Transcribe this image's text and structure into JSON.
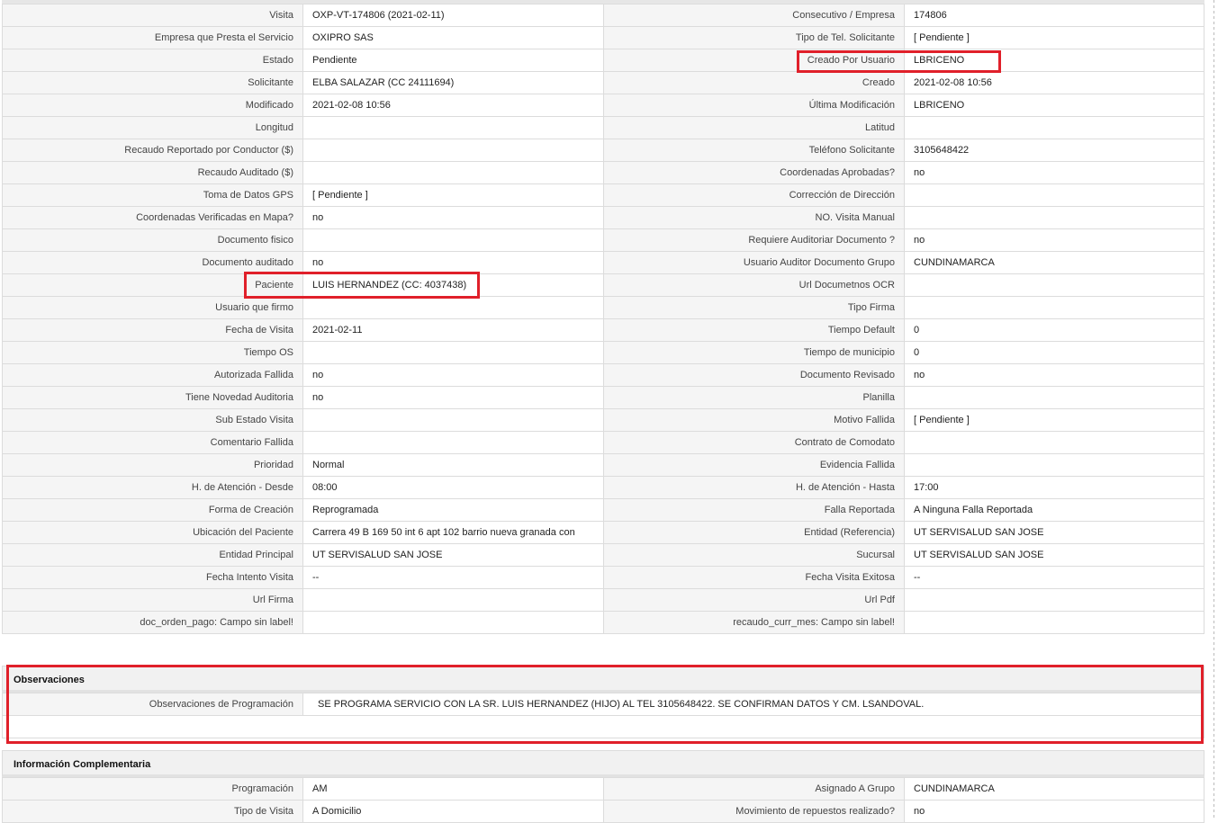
{
  "main_rows": [
    {
      "l1": "Visita",
      "v1": "OXP-VT-174806 (2021-02-11)",
      "l2": "Consecutivo / Empresa",
      "v2": "174806"
    },
    {
      "l1": "Empresa que Presta el Servicio",
      "v1": "OXIPRO SAS",
      "l2": "Tipo de Tel. Solicitante",
      "v2": "[ Pendiente ]"
    },
    {
      "l1": "Estado",
      "v1": "Pendiente",
      "l2": "Creado Por Usuario",
      "v2": "LBRICENO"
    },
    {
      "l1": "Solicitante",
      "v1": "ELBA SALAZAR (CC 24111694)",
      "l2": "Creado",
      "v2": "2021-02-08 10:56"
    },
    {
      "l1": "Modificado",
      "v1": "2021-02-08 10:56",
      "l2": "Última Modificación",
      "v2": " LBRICENO"
    },
    {
      "l1": "Longitud",
      "v1": "",
      "l2": "Latitud",
      "v2": ""
    },
    {
      "l1": "Recaudo Reportado por Conductor ($)",
      "v1": "",
      "l2": "Teléfono Solicitante",
      "v2": "3105648422"
    },
    {
      "l1": "Recaudo Auditado ($)",
      "v1": "",
      "l2": "Coordenadas Aprobadas?",
      "v2": " no"
    },
    {
      "l1": "Toma de Datos GPS",
      "v1": "[ Pendiente ]",
      "l2": "Corrección de Dirección",
      "v2": ""
    },
    {
      "l1": "Coordenadas Verificadas en Mapa?",
      "v1": " no",
      "l2": "NO. Visita Manual",
      "v2": ""
    },
    {
      "l1": "Documento fisico",
      "v1": "",
      "l2": "Requiere Auditoriar Documento ?",
      "v2": " no"
    },
    {
      "l1": "Documento auditado",
      "v1": "no",
      "l2": "Usuario Auditor Documento Grupo",
      "v2": "CUNDINAMARCA"
    },
    {
      "l1": "Paciente",
      "v1": "LUIS HERNANDEZ (CC: 4037438)",
      "l2": "Url Documetnos OCR",
      "v2": ""
    },
    {
      "l1": "Usuario que firmo",
      "v1": "",
      "l2": "Tipo Firma",
      "v2": ""
    },
    {
      "l1": "Fecha de Visita",
      "v1": " 2021-02-11",
      "l2": "Tiempo Default",
      "v2": "0"
    },
    {
      "l1": "Tiempo OS",
      "v1": "",
      "l2": "Tiempo de municipio",
      "v2": "0"
    },
    {
      "l1": "Autorizada Fallida",
      "v1": "no",
      "l2": "Documento Revisado",
      "v2": " no"
    },
    {
      "l1": "Tiene Novedad Auditoria",
      "v1": "no",
      "l2": "Planilla",
      "v2": ""
    },
    {
      "l1": "Sub Estado Visita",
      "v1": "",
      "l2": "Motivo Fallida",
      "v2": "[ Pendiente ]"
    },
    {
      "l1": "Comentario Fallida",
      "v1": "",
      "l2": "Contrato de Comodato",
      "v2": ""
    },
    {
      "l1": "Prioridad",
      "v1": "Normal",
      "l2": "Evidencia Fallida",
      "v2": ""
    },
    {
      "l1": "H. de Atención - Desde",
      "v1": "08:00",
      "l2": "H. de Atención - Hasta",
      "v2": "17:00"
    },
    {
      "l1": "Forma de Creación",
      "v1": "Reprogramada",
      "l2": "Falla Reportada",
      "v2": "A Ninguna Falla Reportada"
    },
    {
      "l1": "Ubicación del Paciente",
      "v1": "Carrera 49 B 169 50 int 6 apt 102 barrio nueva granada con",
      "l2": "Entidad (Referencia)",
      "v2": "UT SERVISALUD SAN JOSE"
    },
    {
      "l1": "Entidad Principal",
      "v1": "UT SERVISALUD SAN JOSE",
      "l2": "Sucursal",
      "v2": "UT SERVISALUD SAN JOSE"
    },
    {
      "l1": "Fecha Intento Visita",
      "v1": "--",
      "l2": "Fecha Visita Exitosa",
      "v2": "--"
    },
    {
      "l1": "Url Firma",
      "v1": "",
      "l2": "Url Pdf",
      "v2": ""
    },
    {
      "l1": "doc_orden_pago: Campo sin label!",
      "v1": "",
      "l2": "recaudo_curr_mes: Campo sin label!",
      "v2": ""
    }
  ],
  "observaciones": {
    "title": "Observaciones",
    "label": "Observaciones de Programación",
    "value": "SE PROGRAMA SERVICIO CON LA SR. LUIS HERNANDEZ (HIJO) AL TEL 3105648422. SE CONFIRMAN DATOS Y CM. LSANDOVAL."
  },
  "info_complementaria": {
    "title": "Información Complementaria",
    "rows": [
      {
        "l1": "Programación",
        "v1": "AM",
        "l2": "Asignado A Grupo",
        "v2": "CUNDINAMARCA"
      },
      {
        "l1": "Tipo de Visita",
        "v1": "A Domicilio",
        "l2": "Movimiento de repuestos realizado?",
        "v2": " no"
      }
    ]
  },
  "colors": {
    "highlight": "#e0202a",
    "label_bg": "#f5f5f5",
    "border": "#dcdcdc"
  }
}
